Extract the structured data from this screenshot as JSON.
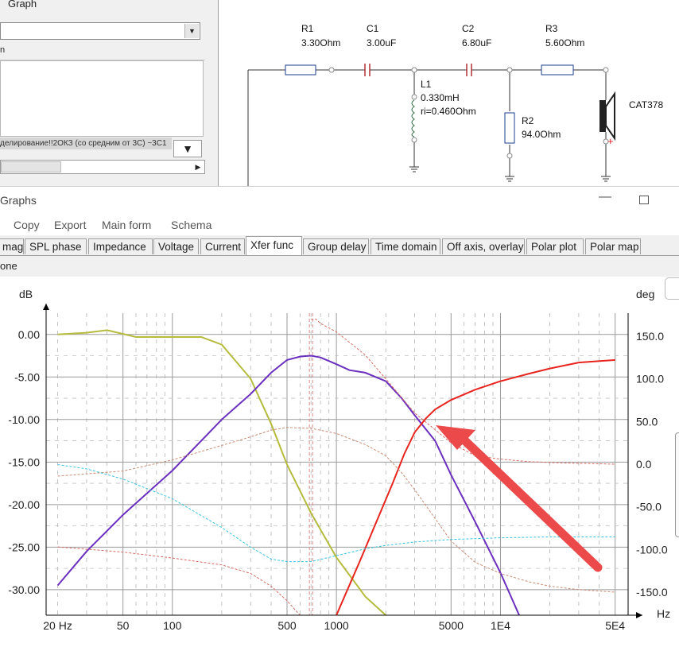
{
  "left_panel": {
    "graph_label": "Graph",
    "box_header": "n",
    "tooltip_text": "делирование!!2ОКЗ (со средним от 3С) ~3С1",
    "scroll_down_glyph": "▼",
    "scroll_right_glyph": "▶",
    "select_arrow_glyph": "▼"
  },
  "schematic": {
    "components": [
      {
        "name": "R1",
        "value": "3.30Ohm"
      },
      {
        "name": "C1",
        "value": "3.00uF"
      },
      {
        "name": "C2",
        "value": "6.80uF"
      },
      {
        "name": "R3",
        "value": "5.60Ohm"
      },
      {
        "name": "L1",
        "value": "0.330mH",
        "extra": "ri=0.460Ohm"
      },
      {
        "name": "R2",
        "value": "94.0Ohm"
      }
    ],
    "speaker": "CAT378",
    "polarity": "+"
  },
  "window": {
    "title": "Graphs",
    "minimize_glyph": "—"
  },
  "menu": [
    "Copy",
    "Export",
    "Main form",
    "Schema"
  ],
  "tabs": [
    {
      "label": "mag",
      "active": false
    },
    {
      "label": "SPL phase",
      "active": false
    },
    {
      "label": "Impedance",
      "active": false
    },
    {
      "label": "Voltage",
      "active": false
    },
    {
      "label": "Current",
      "active": false
    },
    {
      "label": "Xfer func",
      "active": true
    },
    {
      "label": "Group delay",
      "active": false
    },
    {
      "label": "Time domain",
      "active": false
    },
    {
      "label": "Off axis, overlay",
      "active": false
    },
    {
      "label": "Polar plot",
      "active": false
    },
    {
      "label": "Polar map",
      "active": false
    }
  ],
  "subbar": "one",
  "chart_data": {
    "type": "line",
    "ylabel": "dB",
    "y2label": "deg",
    "xlabel": "Hz",
    "xscale": "log",
    "xlim": [
      17,
      60000
    ],
    "ylim": [
      -33,
      2.5
    ],
    "y2lim": [
      -177,
      177
    ],
    "x_ticks": [
      "20 Hz",
      "50",
      "100",
      "500",
      "1000",
      "5000",
      "1E4",
      "5E4"
    ],
    "x_tick_values": [
      20,
      50,
      100,
      500,
      1000,
      5000,
      10000,
      50000
    ],
    "y_ticks": [
      "0.00",
      "-5.00",
      "-10.00",
      "-15.00",
      "-20.00",
      "-25.00",
      "-30.00"
    ],
    "y_tick_values": [
      0,
      -5,
      -10,
      -15,
      -20,
      -25,
      -30
    ],
    "y2_ticks": [
      "150.0",
      "100.0",
      "50.0",
      "0.0",
      "-50.0",
      "-100.0",
      "-150.0"
    ],
    "y2_tick_values": [
      150,
      100,
      50,
      0,
      -50,
      -100,
      -150
    ],
    "marker_x": 700,
    "grid": true,
    "series": [
      {
        "color": "#b5bb3c",
        "axis": "left",
        "dash": false,
        "x": [
          20,
          30,
          40,
          60,
          100,
          150,
          200,
          300,
          400,
          500,
          700,
          1000,
          1500,
          2000
        ],
        "y": [
          0,
          0.2,
          0.5,
          -0.3,
          -0.3,
          -0.3,
          -1.2,
          -5.2,
          -10.5,
          -15.3,
          -21.0,
          -26.2,
          -30.8,
          -33.0
        ]
      },
      {
        "color": "#6a2fbf",
        "axis": "left",
        "dash": false,
        "x": [
          20,
          30,
          50,
          100,
          150,
          200,
          300,
          400,
          500,
          600,
          700,
          800,
          1000,
          1200,
          1500,
          2000,
          2500,
          3000,
          4000,
          5000,
          7000,
          10000,
          13000
        ],
        "y": [
          -29.5,
          -25.5,
          -21.2,
          -16.0,
          -12.5,
          -10.0,
          -7.0,
          -4.5,
          -3.0,
          -2.6,
          -2.5,
          -2.7,
          -3.5,
          -4.2,
          -4.5,
          -5.5,
          -7.5,
          -9.5,
          -12.5,
          -16.5,
          -22.0,
          -28.0,
          -33.0
        ]
      },
      {
        "color": "#e8241e",
        "axis": "left",
        "dash": false,
        "x": [
          1000,
          1400,
          1800,
          2200,
          2600,
          3000,
          3500,
          4000,
          5000,
          7000,
          10000,
          15000,
          20000,
          30000,
          50000
        ],
        "y": [
          -33.0,
          -26.5,
          -21.5,
          -17.5,
          -14.0,
          -11.5,
          -9.9,
          -8.8,
          -7.7,
          -6.5,
          -5.5,
          -4.6,
          -4.0,
          -3.3,
          -3.0
        ]
      },
      {
        "color": "#c98c74",
        "axis": "right",
        "dash": true,
        "x": [
          20,
          50,
          100,
          200,
          300,
          400,
          500,
          700,
          1000,
          1500,
          2000,
          2500,
          3000,
          5000,
          7000,
          10000,
          15000,
          20000,
          30000,
          50000
        ],
        "y": [
          -14,
          -8,
          5,
          22,
          32,
          40,
          43,
          42,
          36,
          23,
          10,
          -10,
          -30,
          -90,
          -115,
          -128,
          -138,
          -143,
          -147,
          -150
        ]
      },
      {
        "color": "#d86a62",
        "axis": "right",
        "dash": true,
        "x": [
          20,
          50,
          100,
          200,
          300,
          400,
          500,
          600,
          650,
          700,
          750,
          800,
          1000,
          1500,
          2000,
          3000,
          5000,
          7000,
          10000,
          15000,
          20000,
          30000,
          50000
        ],
        "y": [
          -97,
          -103,
          -110,
          -118,
          -128,
          -143,
          -160,
          -177,
          -177,
          170,
          170,
          165,
          155,
          128,
          100,
          60,
          25,
          10,
          6,
          3,
          2,
          1,
          0
        ]
      },
      {
        "color": "#38c2e0",
        "axis": "left",
        "dash": true,
        "x": [
          20,
          30,
          50,
          100,
          200,
          300,
          400,
          500,
          700,
          1000,
          1500,
          2000,
          3000,
          5000,
          10000,
          20000,
          50000
        ],
        "y": [
          -15.3,
          -15.8,
          -17.0,
          -19.3,
          -22.7,
          -25.0,
          -26.4,
          -26.7,
          -26.7,
          -26.0,
          -25.2,
          -24.8,
          -24.4,
          -24.1,
          -23.9,
          -23.8,
          -23.8
        ]
      }
    ]
  }
}
